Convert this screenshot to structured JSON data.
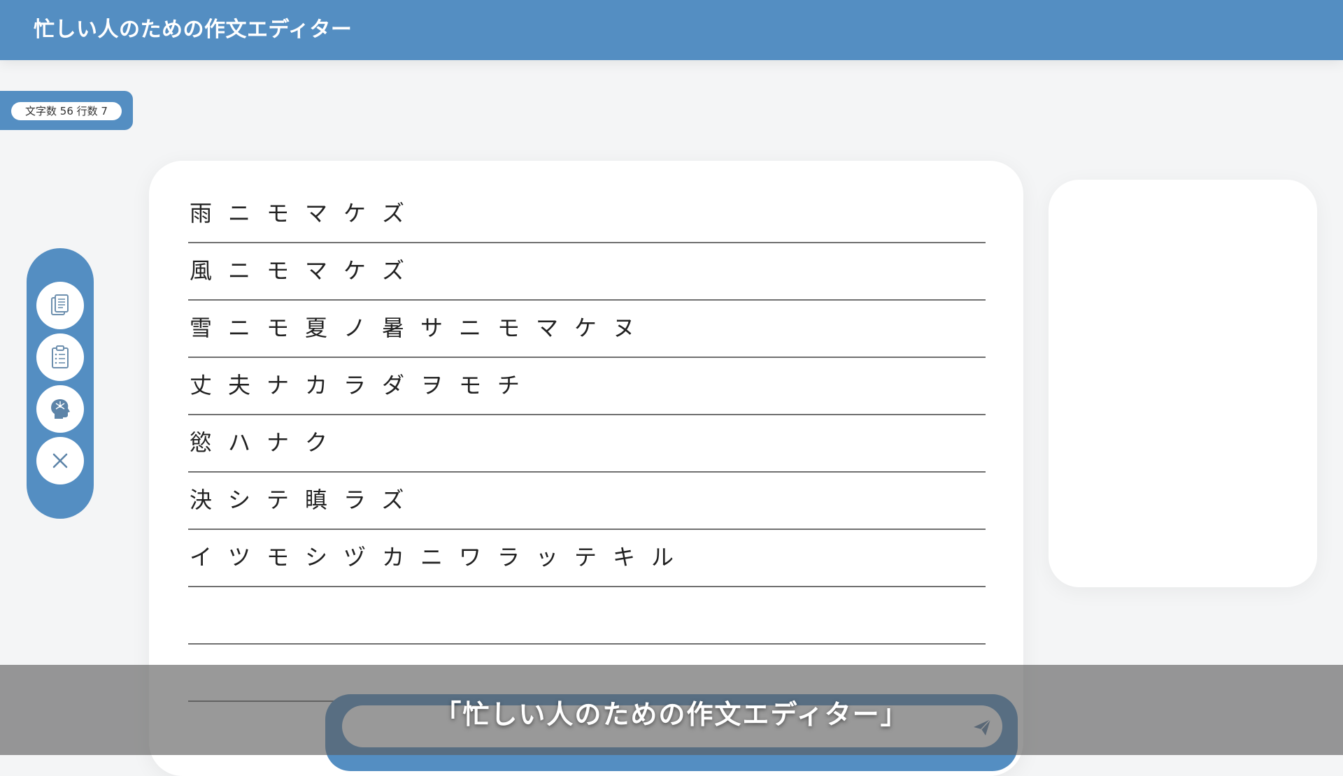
{
  "app": {
    "title": "忙しい人のための作文エディター"
  },
  "stats": {
    "label": "文字数 56 行数 7"
  },
  "toolbar": {
    "buttons": [
      {
        "icon": "copy-documents-icon"
      },
      {
        "icon": "clipboard-list-icon"
      },
      {
        "icon": "head-idea-icon"
      },
      {
        "icon": "close-icon"
      }
    ]
  },
  "editor": {
    "lines": [
      "雨ニモマケズ",
      "風ニモマケズ",
      "雪ニモ夏ノ暑サニモマケヌ",
      "丈夫ナカラダヲモチ",
      "慾ハナク",
      "決シテ瞋ラズ",
      "イツモシヅカニワラッテキル",
      "",
      ""
    ]
  },
  "input": {
    "value": "",
    "placeholder": "",
    "send_icon": "send-icon"
  },
  "caption": {
    "text": "「忙しい人のための作文エディター」"
  },
  "colors": {
    "accent": "#548ec2",
    "background": "#f4f5f6",
    "surface": "#ffffff"
  }
}
